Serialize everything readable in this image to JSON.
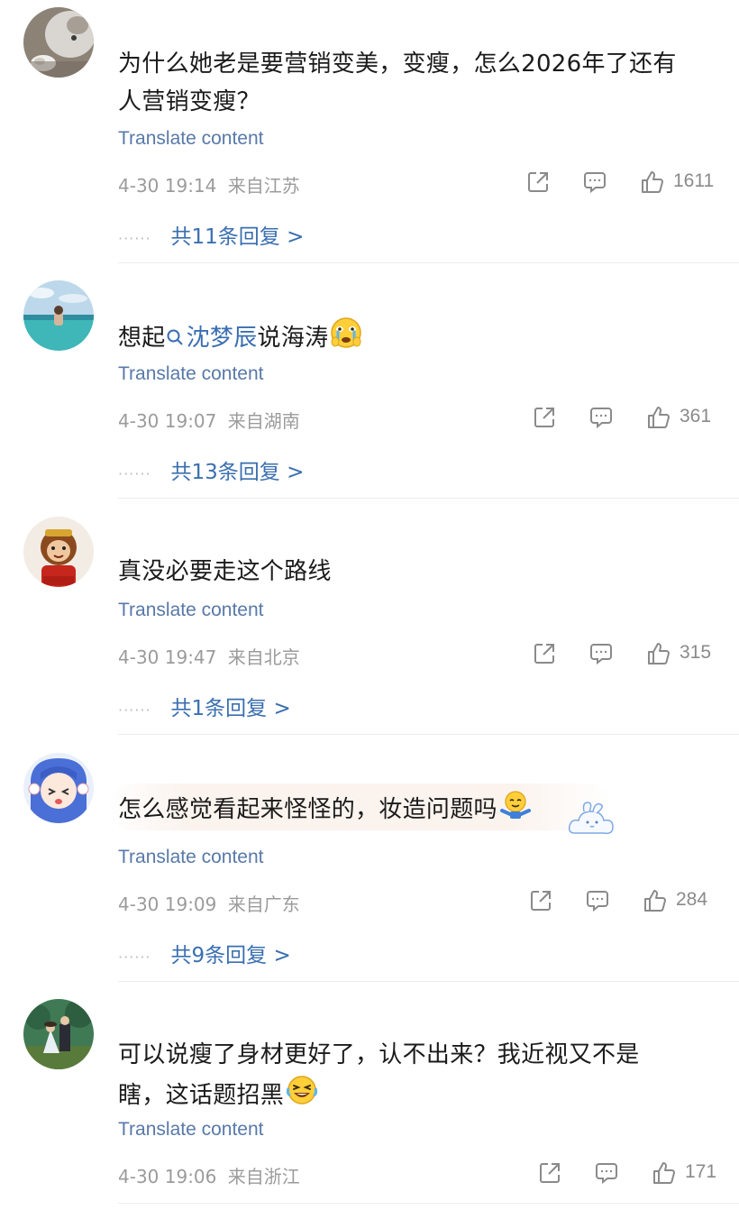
{
  "comments": [
    {
      "text_part1": "为什么她老是要营销变美，变瘦，怎么2026年了还有",
      "text_part2": "人营销变瘦？",
      "translate": "Translate content",
      "time": "4-30 19:14",
      "location": "来自江苏",
      "likes": "1611",
      "replies": "共11条回复 >"
    },
    {
      "text_before": "想起",
      "mention": "沈梦辰",
      "text_after": "说海涛",
      "translate": "Translate content",
      "time": "4-30 19:07",
      "location": "来自湖南",
      "likes": "361",
      "replies": "共13条回复 >"
    },
    {
      "text": "真没必要走这个路线",
      "translate": "Translate content",
      "time": "4-30 19:47",
      "location": "来自北京",
      "likes": "315",
      "replies": "共1条回复 >"
    },
    {
      "text": "怎么感觉看起来怪怪的，妆造问题吗",
      "translate": "Translate content",
      "time": "4-30 19:09",
      "location": "来自广东",
      "likes": "284",
      "replies": "共9条回复 >"
    },
    {
      "text_part1": "可以说瘦了身材更好了，认不出来？我近视又不是",
      "text_part2": "瞎，这话题招黑",
      "translate": "Translate content",
      "time": "4-30 19:06",
      "location": "来自浙江",
      "likes": "171"
    }
  ],
  "icons": {
    "share": "share-icon",
    "comment": "comment-icon",
    "like": "thumbs-up-icon",
    "mention_search": "search-icon"
  },
  "colors": {
    "link": "#3a6fb0",
    "translate": "#5879a8",
    "meta": "#9b9b9b"
  }
}
